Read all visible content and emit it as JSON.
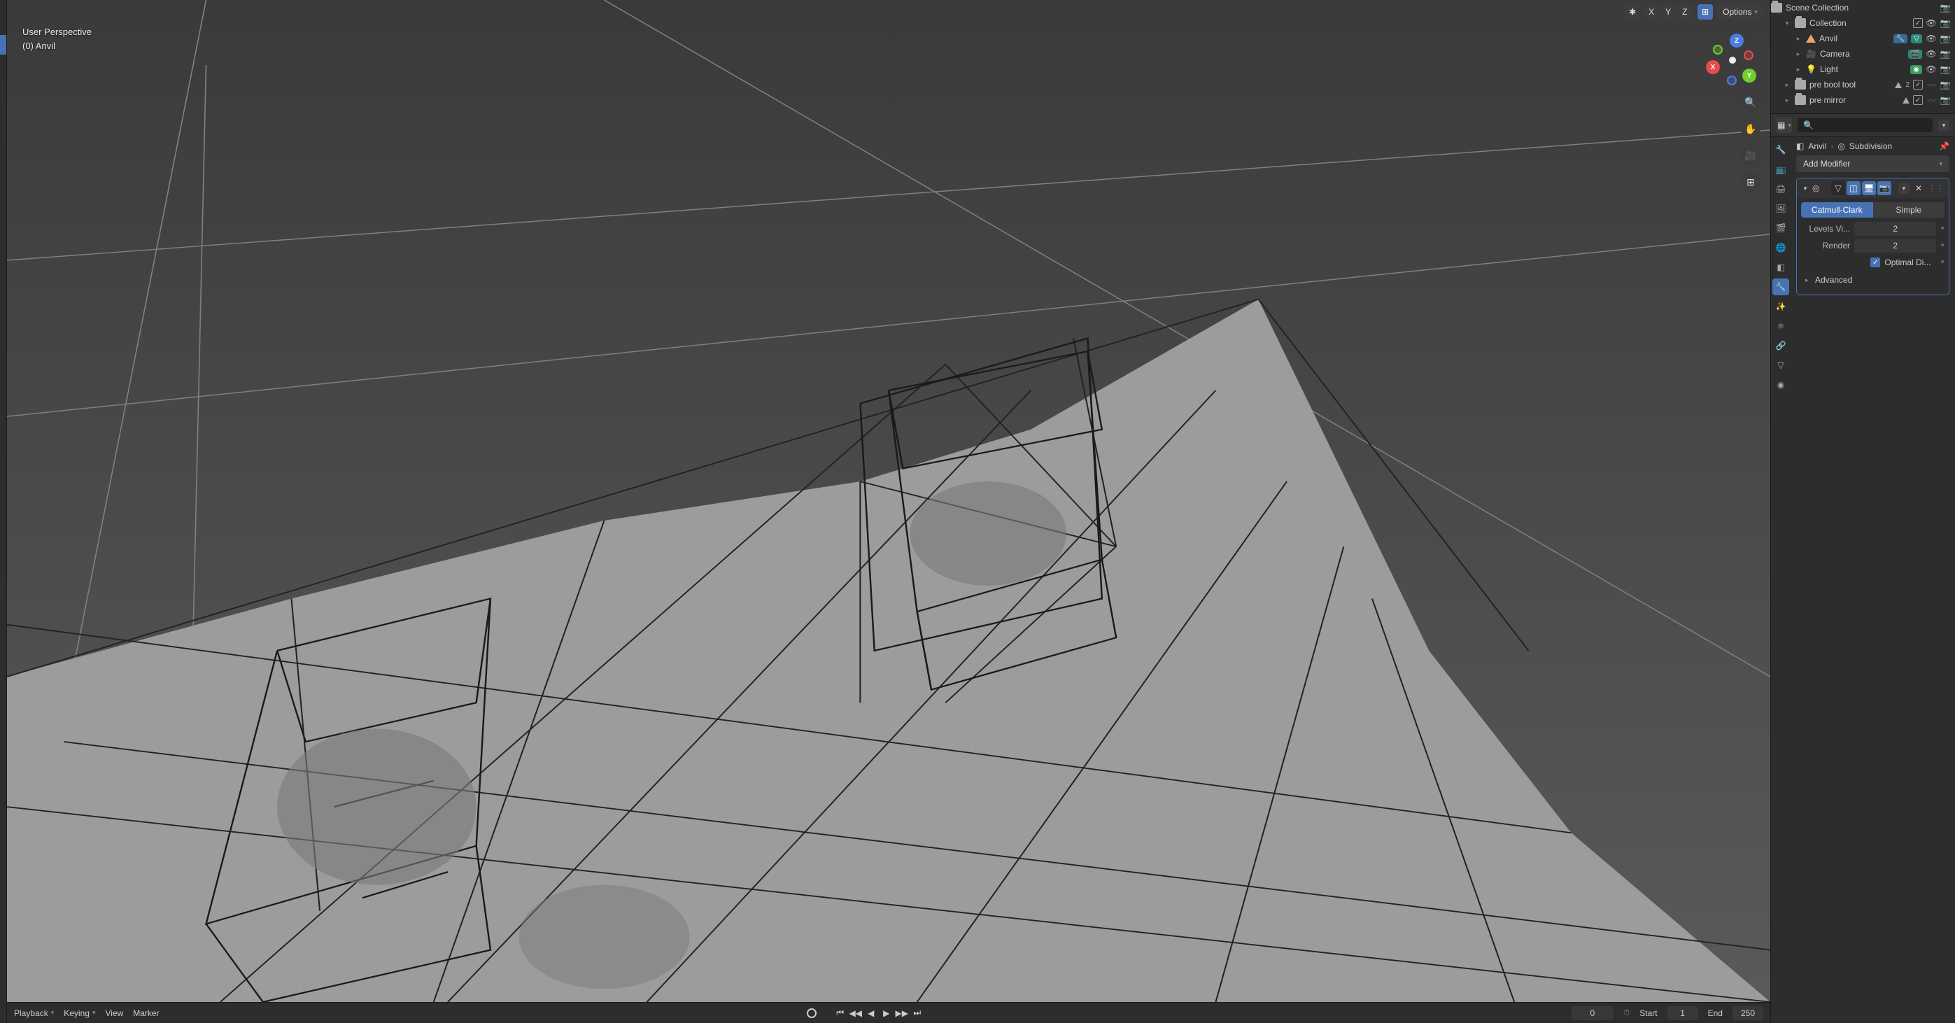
{
  "viewport": {
    "overlay_line1": "User Perspective",
    "overlay_line2": "(0) Anvil",
    "axis_x": "X",
    "axis_y": "Y",
    "axis_z": "Z",
    "options_label": "Options"
  },
  "timeline": {
    "playback": "Playback",
    "keying": "Keying",
    "view": "View",
    "marker": "Marker",
    "current_frame": "0",
    "start_label": "Start",
    "start_val": "1",
    "end_label": "End",
    "end_val": "250"
  },
  "outliner": {
    "scene_collection": "Scene Collection",
    "collection": "Collection",
    "anvil": "Anvil",
    "camera": "Camera",
    "light": "Light",
    "pre_bool": "pre bool tool",
    "pre_bool_count": "2",
    "pre_mirror": "pre mirror"
  },
  "properties": {
    "breadcrumb_obj": "Anvil",
    "breadcrumb_mod": "Subdivision",
    "add_modifier": "Add Modifier",
    "catmull": "Catmull-Clark",
    "simple": "Simple",
    "levels_label": "Levels Vi...",
    "levels_val": "2",
    "render_label": "Render",
    "render_val": "2",
    "optimal_label": "Optimal Di...",
    "advanced": "Advanced"
  },
  "search": {
    "placeholder": ""
  }
}
